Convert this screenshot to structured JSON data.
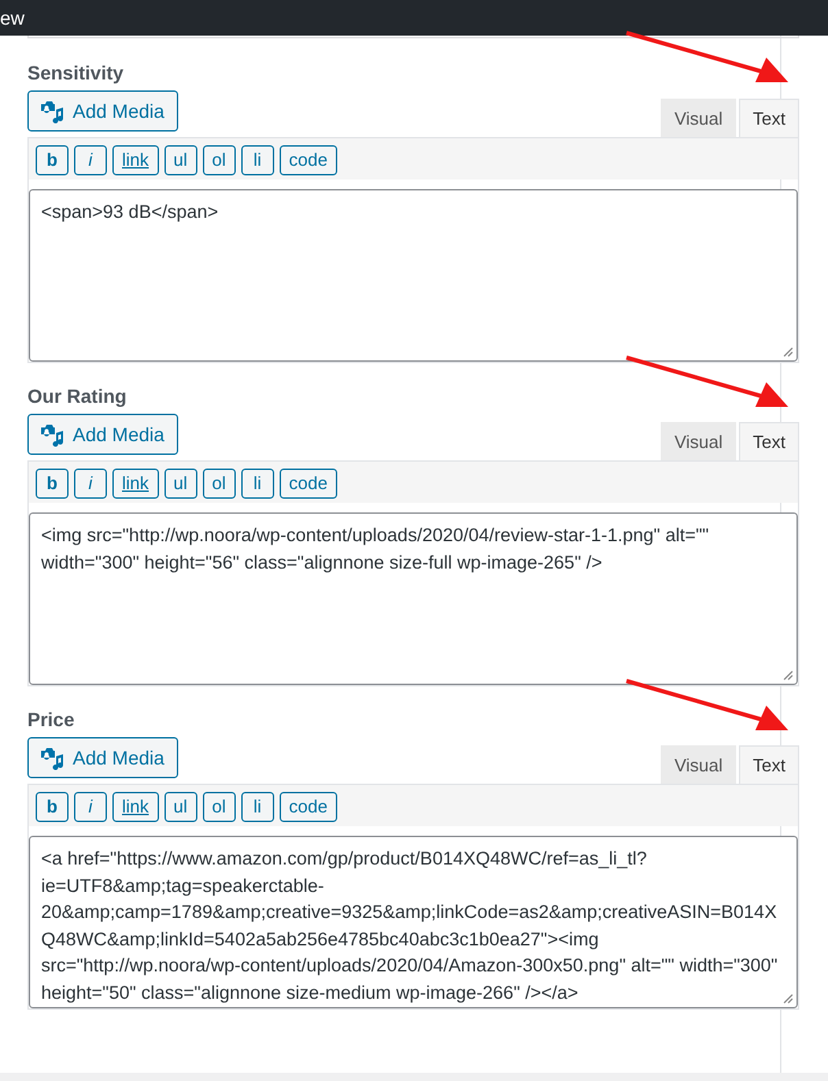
{
  "top_bar": {
    "title": "ew"
  },
  "fields": [
    {
      "label": "Sensitivity",
      "add_media": "Add Media",
      "arrow": true,
      "tabs": [
        {
          "label": "Visual",
          "selected": false
        },
        {
          "label": "Text",
          "selected": true
        }
      ],
      "toolbar": [
        {
          "label": "b",
          "kind": "bold"
        },
        {
          "label": "i",
          "kind": "italic"
        },
        {
          "label": "link",
          "kind": "link"
        },
        {
          "label": "ul",
          "kind": "plain"
        },
        {
          "label": "ol",
          "kind": "plain"
        },
        {
          "label": "li",
          "kind": "plain"
        },
        {
          "label": "code",
          "kind": "plain"
        }
      ],
      "content": "<span>93 dB</span>"
    },
    {
      "label": "Our Rating",
      "add_media": "Add Media",
      "arrow": true,
      "tabs": [
        {
          "label": "Visual",
          "selected": false
        },
        {
          "label": "Text",
          "selected": true
        }
      ],
      "toolbar": [
        {
          "label": "b",
          "kind": "bold"
        },
        {
          "label": "i",
          "kind": "italic"
        },
        {
          "label": "link",
          "kind": "link"
        },
        {
          "label": "ul",
          "kind": "plain"
        },
        {
          "label": "ol",
          "kind": "plain"
        },
        {
          "label": "li",
          "kind": "plain"
        },
        {
          "label": "code",
          "kind": "plain"
        }
      ],
      "content": "<img src=\"http://wp.noora/wp-content/uploads/2020/04/review-star-1-1.png\" alt=\"\" width=\"300\" height=\"56\" class=\"alignnone size-full wp-image-265\" />"
    },
    {
      "label": "Price",
      "add_media": "Add Media",
      "arrow": true,
      "tabs": [
        {
          "label": "Visual",
          "selected": false
        },
        {
          "label": "Text",
          "selected": true
        }
      ],
      "toolbar": [
        {
          "label": "b",
          "kind": "bold"
        },
        {
          "label": "i",
          "kind": "italic"
        },
        {
          "label": "link",
          "kind": "link"
        },
        {
          "label": "ul",
          "kind": "plain"
        },
        {
          "label": "ol",
          "kind": "plain"
        },
        {
          "label": "li",
          "kind": "plain"
        },
        {
          "label": "code",
          "kind": "plain"
        }
      ],
      "content": "<a href=\"https://www.amazon.com/gp/product/B014XQ48WC/ref=as_li_tl?ie=UTF8&amp;tag=speakerctable-20&amp;camp=1789&amp;creative=9325&amp;linkCode=as2&amp;creativeASIN=B014XQ48WC&amp;linkId=5402a5ab256e4785bc40abc3c1b0ea27\"><img src=\"http://wp.noora/wp-content/uploads/2020/04/Amazon-300x50.png\" alt=\"\" width=\"300\" height=\"50\" class=\"alignnone size-medium wp-image-266\" /></a>"
    }
  ]
}
